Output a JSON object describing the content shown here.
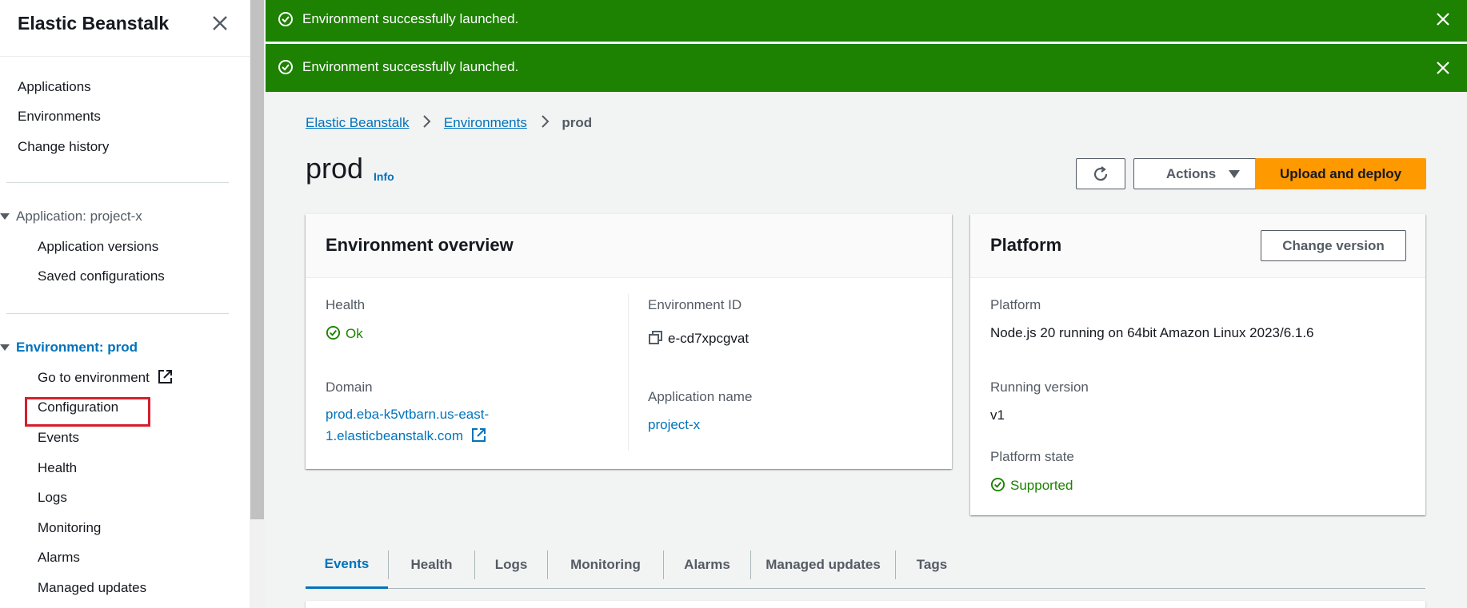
{
  "sidebar": {
    "title": "Elastic Beanstalk",
    "top_links": [
      "Applications",
      "Environments",
      "Change history"
    ],
    "application_section": "Application: project-x",
    "application_links": [
      "Application versions",
      "Saved configurations"
    ],
    "environment_section": "Environment: prod",
    "environment_links": [
      "Go to environment",
      "Configuration",
      "Events",
      "Health",
      "Logs",
      "Monitoring",
      "Alarms",
      "Managed updates"
    ]
  },
  "flash": [
    {
      "message": "Environment successfully launched."
    },
    {
      "message": "Environment successfully launched."
    }
  ],
  "breadcrumb": {
    "items": [
      "Elastic Beanstalk",
      "Environments"
    ],
    "current": "prod"
  },
  "page": {
    "title": "prod",
    "info": "Info"
  },
  "actions": {
    "actions_label": "Actions",
    "upload_label": "Upload and deploy"
  },
  "overview": {
    "title": "Environment overview",
    "health_key": "Health",
    "health_value": "Ok",
    "env_id_key": "Environment ID",
    "env_id_value": "e-cd7xpcgvat",
    "domain_key": "Domain",
    "domain_line1": "prod.eba-k5vtbarn.us-east-",
    "domain_line2": "1.elasticbeanstalk.com",
    "app_name_key": "Application name",
    "app_name_value": "project-x"
  },
  "platform": {
    "title": "Platform",
    "change_version_label": "Change version",
    "platform_key": "Platform",
    "platform_value": "Node.js 20 running on 64bit Amazon Linux 2023/6.1.6",
    "running_version_key": "Running version",
    "running_version_value": "v1",
    "state_key": "Platform state",
    "state_value": "Supported"
  },
  "tabs": [
    "Events",
    "Health",
    "Logs",
    "Monitoring",
    "Alarms",
    "Managed updates",
    "Tags"
  ],
  "colors": {
    "success": "#1d8102",
    "link": "#0073bb",
    "primary": "#ff9900",
    "highlight": "#d41e2c"
  }
}
